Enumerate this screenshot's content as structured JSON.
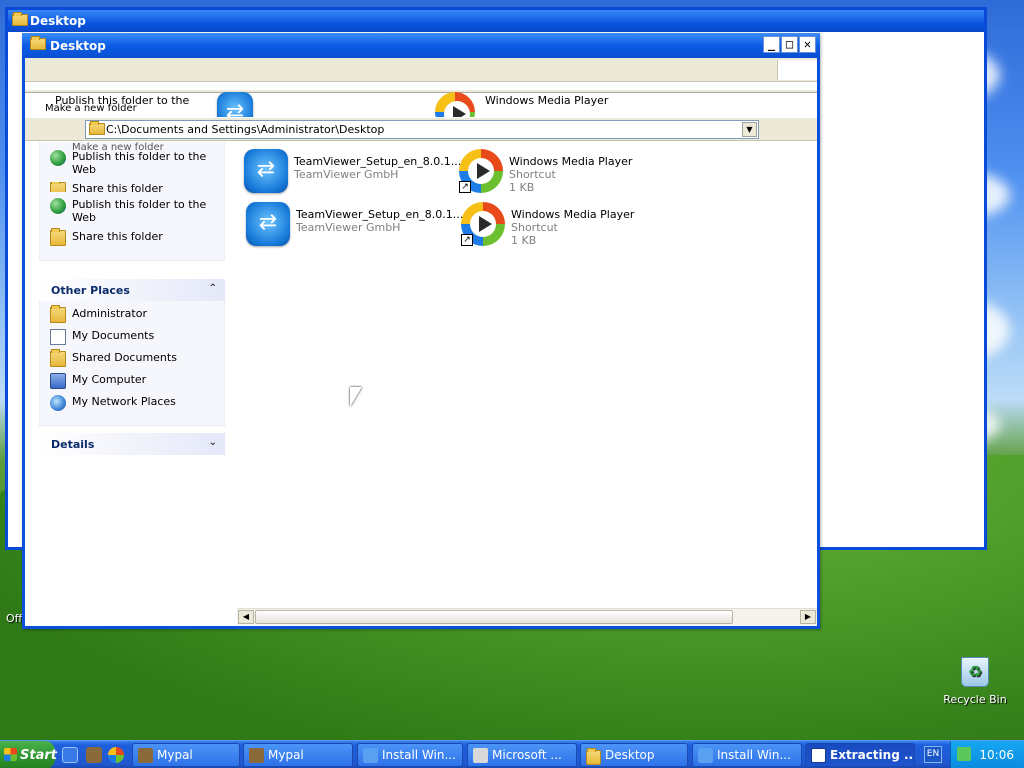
{
  "back_window": {
    "title": "Desktop"
  },
  "window": {
    "title": "Desktop",
    "buttons": {
      "minimize": "_",
      "maximize": "□",
      "close": "✕"
    },
    "ghost": {
      "text1": "Publish this folder to the",
      "text2": "Make a new folder",
      "text3": "Windows Media Player"
    },
    "address": {
      "value": "C:\\Documents and Settings\\Administrator\\Desktop",
      "dropdown": "▼"
    },
    "tasks": {
      "ghost1": "Make a new folder",
      "ghost2": "Share this folder",
      "items": [
        {
          "label": "Publish this folder to the Web",
          "icon": "globe-icon"
        },
        {
          "label": "Share this folder",
          "icon": "share-folder-icon"
        }
      ],
      "items_top": [
        {
          "label": "Publish this folder to the Web",
          "icon": "globe-icon"
        },
        {
          "label": "Share this folder",
          "icon": "share-folder-icon"
        }
      ]
    },
    "other_places": {
      "title": "Other Places",
      "collapse": "⌃",
      "items": [
        {
          "label": "Administrator",
          "icon": "folder-icon"
        },
        {
          "label": "My Documents",
          "icon": "documents-icon"
        },
        {
          "label": "Shared Documents",
          "icon": "folder-icon"
        },
        {
          "label": "My Computer",
          "icon": "computer-icon"
        },
        {
          "label": "My Network Places",
          "icon": "network-icon"
        }
      ]
    },
    "details": {
      "title": "Details",
      "expand": "⌄"
    },
    "files": [
      {
        "name": "TeamViewer_Setup_en_8.0.1...",
        "sub1": "TeamViewer GmbH",
        "sub2": "",
        "icon": "teamviewer-icon"
      },
      {
        "name": "Windows Media Player",
        "sub1": "Shortcut",
        "sub2": "1 KB",
        "icon": "wmp-icon"
      },
      {
        "name": "TeamViewer_Setup_en_8.0.1...",
        "sub1": "TeamViewer GmbH",
        "sub2": "",
        "icon": "teamviewer-icon"
      },
      {
        "name": "Windows Media Player",
        "sub1": "Shortcut",
        "sub2": "1 KB",
        "icon": "wmp-icon"
      }
    ],
    "scroll": {
      "left": "◀",
      "right": "▶"
    }
  },
  "desktop": {
    "recycle_bin": "Recycle Bin",
    "off_text": "Off"
  },
  "taskbar": {
    "start": "Start",
    "buttons": [
      {
        "label": "Mypal",
        "active": false
      },
      {
        "label": "Mypal",
        "active": false
      },
      {
        "label": "Install Win...",
        "active": false
      },
      {
        "label": "Microsoft ...",
        "active": false
      },
      {
        "label": "Desktop",
        "active": false
      },
      {
        "label": "Install Win...",
        "active": false
      },
      {
        "label": "Extracting ...",
        "active": true
      }
    ],
    "language": "EN",
    "clock": "10:06"
  },
  "colors": {
    "title_blue": "#0a55e0",
    "taskbar_blue": "#1f5fdc",
    "start_green": "#2e922e"
  }
}
